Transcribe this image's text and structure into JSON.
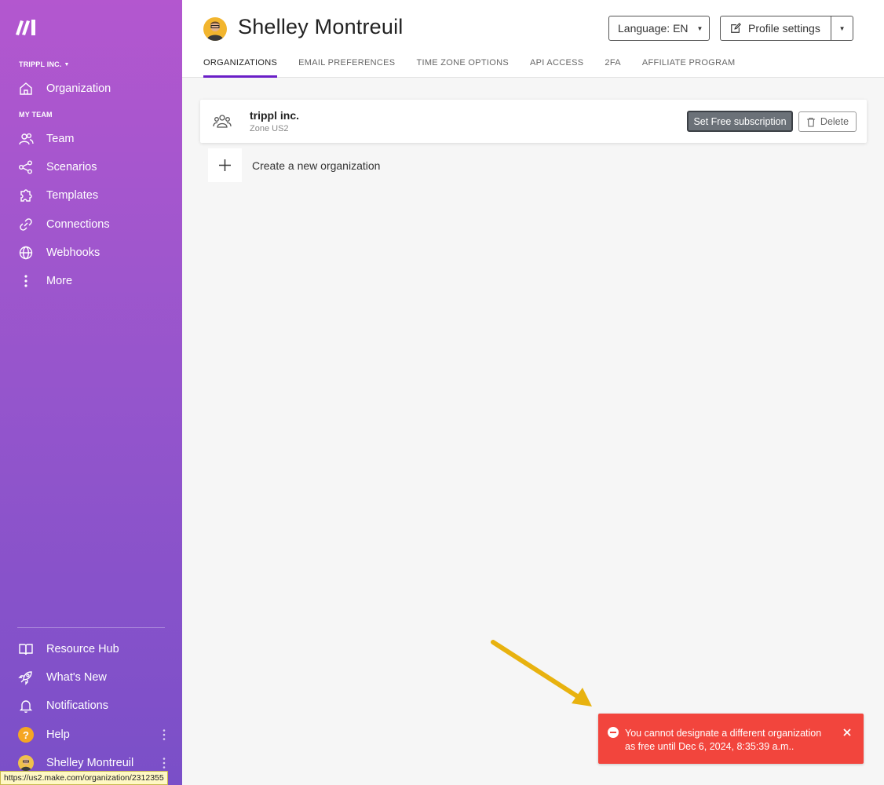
{
  "sidebar": {
    "org_switch": "TRIPPL INC.",
    "org_item": "Organization",
    "my_team_label": "MY TEAM",
    "items": [
      {
        "label": "Team",
        "icon": "team-icon"
      },
      {
        "label": "Scenarios",
        "icon": "share-icon"
      },
      {
        "label": "Templates",
        "icon": "puzzle-icon"
      },
      {
        "label": "Connections",
        "icon": "link-icon"
      },
      {
        "label": "Webhooks",
        "icon": "globe-icon"
      },
      {
        "label": "More",
        "icon": "kebab-icon"
      }
    ],
    "bottom_items": [
      {
        "label": "Resource Hub",
        "icon": "book-icon"
      },
      {
        "label": "What's New",
        "icon": "rocket-icon"
      },
      {
        "label": "Notifications",
        "icon": "bell-icon"
      },
      {
        "label": "Help",
        "icon": "help-icon"
      },
      {
        "label": "Shelley Montreuil",
        "icon": "avatar"
      }
    ],
    "background_top": "#b357cf",
    "background_bottom": "#7a4fc8"
  },
  "status_url": "https://us2.make.com/organization/2312355",
  "header": {
    "user_name": "Shelley Montreuil",
    "language_button": "Language: EN",
    "profile_settings_button": "Profile settings",
    "tabs": [
      {
        "label": "ORGANIZATIONS",
        "active": true
      },
      {
        "label": "EMAIL PREFERENCES",
        "active": false
      },
      {
        "label": "TIME ZONE OPTIONS",
        "active": false
      },
      {
        "label": "API ACCESS",
        "active": false
      },
      {
        "label": "2FA",
        "active": false
      },
      {
        "label": "AFFILIATE PROGRAM",
        "active": false
      }
    ],
    "accent_color": "#6a1fc7"
  },
  "organization": {
    "name": "trippl inc.",
    "zone": "Zone US2",
    "set_free_button": "Set Free subscription",
    "delete_button": "Delete"
  },
  "create_org_label": "Create a new organization",
  "toast": {
    "message": "You cannot designate a different organization as free until Dec 6, 2024, 8:35:39 a.m..",
    "color": "#f2453d"
  }
}
